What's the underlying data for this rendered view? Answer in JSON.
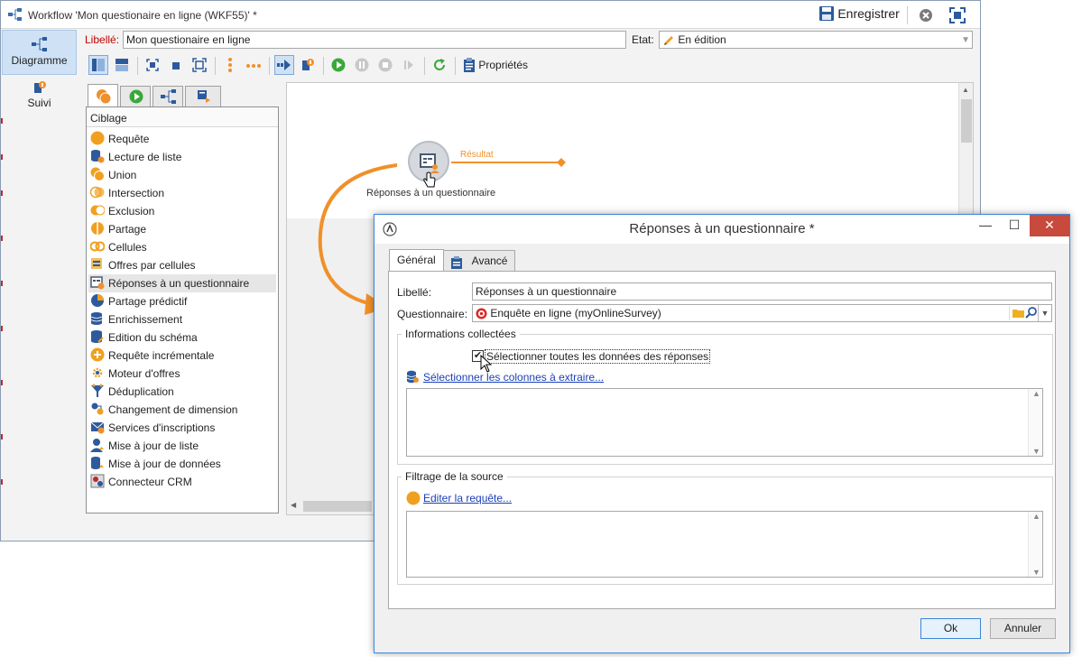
{
  "main_window": {
    "title": "Workflow 'Mon questionaire en ligne (WKF55)' *",
    "save_label": "Enregistrer",
    "nav": {
      "diagram": "Diagramme",
      "tracking": "Suivi"
    },
    "label_caption": "Libellé:",
    "label_value": "Mon questionaire en ligne",
    "state_caption": "Etat:",
    "state_value": "En édition",
    "properties_label": "Propriétés",
    "colors": {
      "accent": "#f0902a",
      "selection": "#cfe2f5",
      "link": "#1a3fb8",
      "label_red": "#c00000"
    }
  },
  "palette": {
    "header": "Ciblage",
    "items": [
      "Requête",
      "Lecture de liste",
      "Union",
      "Intersection",
      "Exclusion",
      "Partage",
      "Cellules",
      "Offres par cellules",
      "Réponses à un questionnaire",
      "Partage prédictif",
      "Enrichissement",
      "Edition du schéma",
      "Requête incrémentale",
      "Moteur d'offres",
      "Déduplication",
      "Changement de dimension",
      "Services d'inscriptions",
      "Mise à jour de liste",
      "Mise à jour de données",
      "Connecteur CRM"
    ],
    "selected_index": 8
  },
  "canvas": {
    "node_label": "Réponses à un questionnaire",
    "transition_label": "Résultat"
  },
  "dialog": {
    "title": "Réponses à un questionnaire *",
    "tabs": [
      "Général",
      "Avancé"
    ],
    "label_caption": "Libellé:",
    "label_value": "Réponses à un questionnaire",
    "questionnaire_caption": "Questionnaire:",
    "questionnaire_value": "Enquête en ligne (myOnlineSurvey)",
    "collected_group": "Informations collectées",
    "select_all_label": "Sélectionner toutes les données des réponses",
    "select_all_checked": true,
    "select_columns_link": "Sélectionner les colonnes à extraire...",
    "filter_group": "Filtrage de la source",
    "edit_query_link": "Editer la requête...",
    "ok_label": "Ok",
    "cancel_label": "Annuler"
  }
}
